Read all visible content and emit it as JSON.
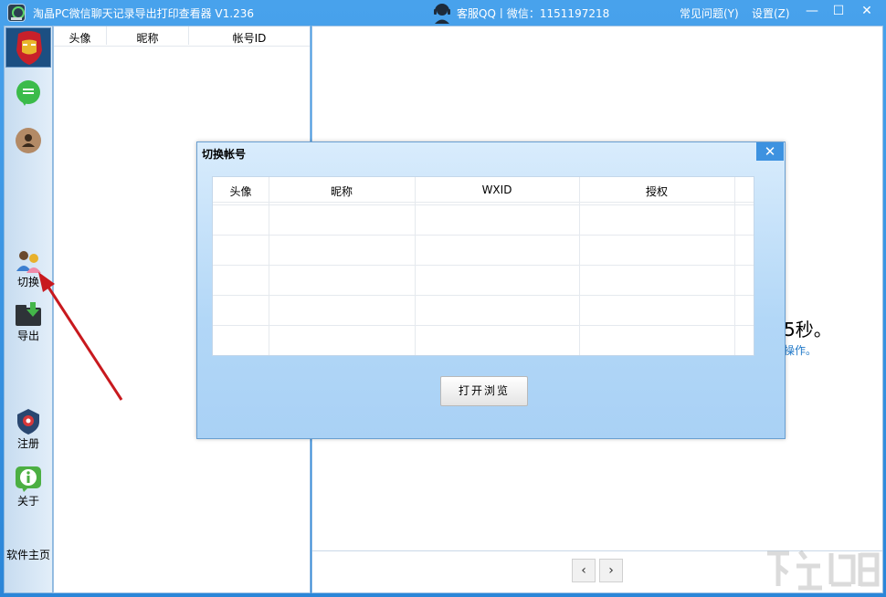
{
  "window": {
    "title": "淘晶PC微信聊天记录导出打印查看器 V1.236",
    "service": "客服QQ丨微信：1151197218",
    "links": {
      "faq": "常见问题(Y)",
      "settings": "设置(Z)"
    },
    "controls": {
      "minimize": "—",
      "maximize": "☐",
      "close": "✕"
    }
  },
  "sidebar": {
    "items": [
      {
        "label": ""
      },
      {
        "label": ""
      },
      {
        "label": "切换"
      },
      {
        "label": "导出"
      },
      {
        "label": "注册"
      },
      {
        "label": "关于"
      },
      {
        "label": "软件主页"
      }
    ]
  },
  "friend_list": {
    "columns": [
      "头像",
      "昵称",
      "帐号ID"
    ]
  },
  "viewer": {
    "notice_big": "5秒。",
    "notice_small": "操作。",
    "pager": {
      "prev": "‹",
      "next": "›"
    }
  },
  "dialog": {
    "title": "切换帐号",
    "close": "✕",
    "columns": [
      "头像",
      "昵称",
      "WXID",
      "授权"
    ],
    "rows": [],
    "button": "打开浏览"
  },
  "colors": {
    "frame": "#3d95e0",
    "dialog_close": "#3d92e0",
    "annotation_arrow": "#c8191e"
  }
}
